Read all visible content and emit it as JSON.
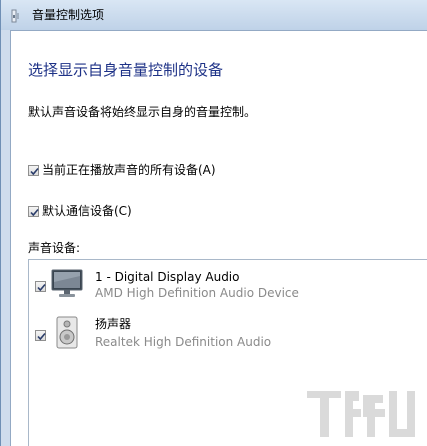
{
  "window": {
    "title": "音量控制选项"
  },
  "main": {
    "heading": "选择显示自身音量控制的设备",
    "description": "默认声音设备将始终显示自身的音量控制。",
    "options": [
      {
        "label": "当前正在播放声音的所有设备(A)",
        "checked": true
      },
      {
        "label": "默认通信设备(C)",
        "checked": true
      }
    ],
    "devices_label": "声音设备:",
    "devices": [
      {
        "name": "1 - Digital Display Audio",
        "subtitle": "AMD High Definition Audio Device",
        "checked": true,
        "icon": "monitor-icon"
      },
      {
        "name": "扬声器",
        "subtitle": "Realtek High Definition Audio",
        "checked": true,
        "icon": "speaker-icon"
      }
    ]
  },
  "watermark": {
    "icon": "watermark-logo-icon"
  }
}
